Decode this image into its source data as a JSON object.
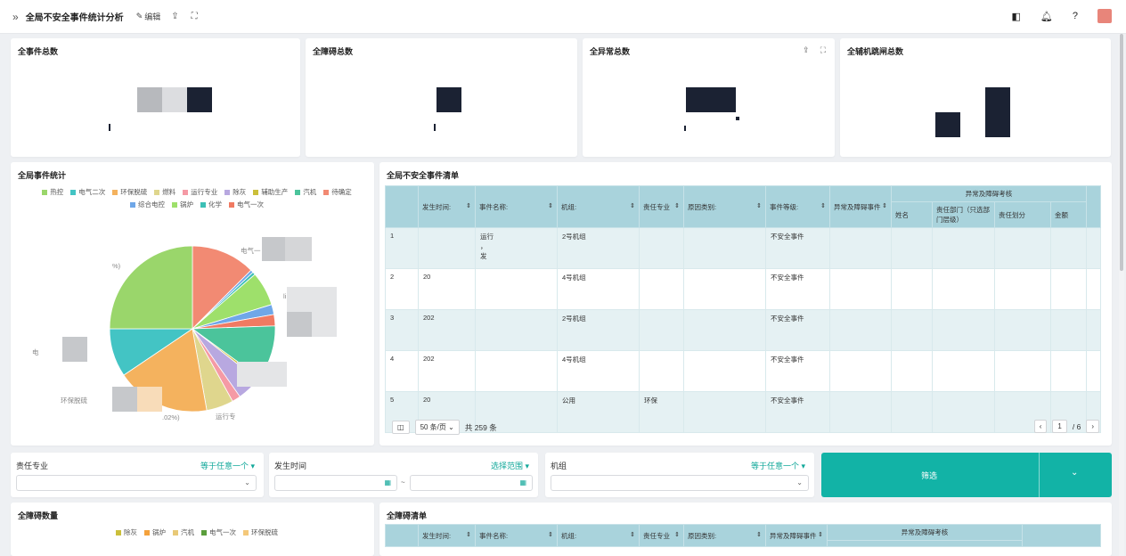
{
  "header": {
    "expand_icon": "double-chevron-right-icon",
    "title": "全局不安全事件统计分析",
    "edit_label": "编辑",
    "share_icon": "share-icon",
    "fullscreen_icon": "fullscreen-icon"
  },
  "kpis": [
    {
      "title": "全事件总数"
    },
    {
      "title": "全障碍总数"
    },
    {
      "title": "全异常总数"
    },
    {
      "title": "全辅机跳闸总数"
    }
  ],
  "event_stats": {
    "title": "全局事件统计",
    "legend": [
      {
        "name": "热控",
        "color": "#9ad66b"
      },
      {
        "name": "电气二次",
        "color": "#43c4c4"
      },
      {
        "name": "环保脱硫",
        "color": "#f4b25e"
      },
      {
        "name": "燃料",
        "color": "#dfd68d"
      },
      {
        "name": "运行专业",
        "color": "#f59aa5"
      },
      {
        "name": "除灰",
        "color": "#b8a8e0"
      },
      {
        "name": "辅助生产",
        "color": "#cbbf3b"
      },
      {
        "name": "汽机",
        "color": "#4bc49b"
      },
      {
        "name": "待确定",
        "color": "#f28a73"
      },
      {
        "name": "综合电控",
        "color": "#6fa7e8"
      },
      {
        "name": "锅炉",
        "color": "#9ee06b"
      },
      {
        "name": "化学",
        "color": "#3cc0b6"
      },
      {
        "name": "电气一次",
        "color": "#f07a62"
      }
    ],
    "labels": {
      "l1": "电气一",
      "l2": "%)",
      "l3": "电",
      "l4": "环保脱硫",
      "l5": ".02%)",
      "l6": "运行专",
      "l7": "li"
    }
  },
  "event_list": {
    "title": "全局不安全事件清单",
    "columns": [
      "",
      "发生时间:",
      "事件名称:",
      "机组:",
      "责任专业",
      "原因类别:",
      "事件等级:",
      "异常及障碍事件"
    ],
    "group_header": "异常及障碍考核",
    "sub_columns": [
      "姓名",
      "责任部门（只选部门层级）",
      "责任划分",
      "金额"
    ],
    "rows": [
      {
        "no": "1",
        "time": "",
        "name": "运行\n，\n发",
        "unit": "2号机组",
        "spec": "",
        "reason": "",
        "level": "不安全事件"
      },
      {
        "no": "2",
        "time": "20",
        "name": "",
        "unit": "4号机组",
        "spec": "",
        "reason": "",
        "level": "不安全事件"
      },
      {
        "no": "3",
        "time": "202",
        "name": "",
        "unit": "2号机组",
        "spec": "",
        "reason": "",
        "level": "不安全事件"
      },
      {
        "no": "4",
        "time": "202",
        "name": "",
        "unit": "4号机组",
        "spec": "",
        "reason": "",
        "level": "不安全事件"
      },
      {
        "no": "5",
        "time": "20",
        "name": "",
        "unit": "公用",
        "spec": "环保",
        "reason": "",
        "level": "不安全事件"
      }
    ],
    "pager": {
      "page_size": "50 条/页",
      "total": "共 259 条",
      "current": "1",
      "pages": "/ 6"
    }
  },
  "filters": {
    "spec_label": "责任专业",
    "spec_mode": "等于任意一个",
    "time_label": "发生时间",
    "time_mode": "选择范围",
    "range_sep": "~",
    "unit_label": "机组",
    "unit_mode": "等于任意一个",
    "button": "筛选"
  },
  "obstacle_count": {
    "title": "全障碍数量",
    "legend": [
      {
        "name": "除灰",
        "color": "#cbbf3b"
      },
      {
        "name": "锅炉",
        "color": "#f4a23c"
      },
      {
        "name": "汽机",
        "color": "#e8c977"
      },
      {
        "name": "电气一次",
        "color": "#5b9e3c"
      },
      {
        "name": "环保脱硫",
        "color": "#f4c87a"
      }
    ]
  },
  "obstacle_list": {
    "title": "全障碍清单",
    "columns": [
      "",
      "发生时间:",
      "事件名称:",
      "机组:",
      "责任专业",
      "原因类别:",
      "异常及障碍事件"
    ],
    "group_header": "异常及障碍考核"
  }
}
